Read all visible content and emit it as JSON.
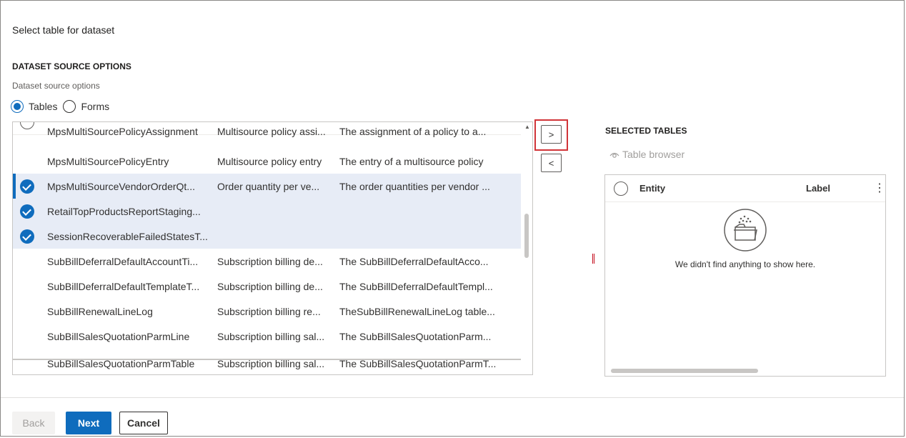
{
  "dialog": {
    "title": "Select table for dataset"
  },
  "source_options": {
    "heading": "DATASET SOURCE OPTIONS",
    "field_label": "Dataset source options",
    "options": [
      {
        "label": "Tables",
        "checked": true
      },
      {
        "label": "Forms",
        "checked": false
      }
    ]
  },
  "available_tables": {
    "rows": [
      {
        "name": "MpsMultiSourcePolicyAssignment",
        "label": "Multisource policy assi...",
        "description": "The assignment of a policy to a...",
        "selected": false
      },
      {
        "name": "MpsMultiSourcePolicyEntry",
        "label": "Multisource policy entry",
        "description": "The entry of a multisource policy",
        "selected": false
      },
      {
        "name": "MpsMultiSourceVendorOrderQt...",
        "label": "Order quantity per ve...",
        "description": "The order quantities per vendor ...",
        "selected": true
      },
      {
        "name": "RetailTopProductsReportStaging...",
        "label": "",
        "description": "",
        "selected": true
      },
      {
        "name": "SessionRecoverableFailedStatesT...",
        "label": "",
        "description": "",
        "selected": true
      },
      {
        "name": "SubBillDeferralDefaultAccountTi...",
        "label": "Subscription billing de...",
        "description": "The SubBillDeferralDefaultAcco...",
        "selected": false
      },
      {
        "name": "SubBillDeferralDefaultTemplateT...",
        "label": "Subscription billing de...",
        "description": "The SubBillDeferralDefaultTempl...",
        "selected": false
      },
      {
        "name": "SubBillRenewalLineLog",
        "label": "Subscription billing re...",
        "description": "TheSubBillRenewalLineLog table...",
        "selected": false
      },
      {
        "name": "SubBillSalesQuotationParmLine",
        "label": "Subscription billing sal...",
        "description": "The SubBillSalesQuotationParm...",
        "selected": false
      },
      {
        "name": "SubBillSalesQuotationParmTable",
        "label": "Subscription billing sal...",
        "description": "The SubBillSalesQuotationParmT...",
        "selected": false
      }
    ]
  },
  "transfer": {
    "add_label": ">",
    "remove_label": "<"
  },
  "selected_tables": {
    "heading": "SELECTED TABLES",
    "table_browser_label": "Table browser",
    "columns": {
      "entity": "Entity",
      "label": "Label",
      "more": "⋮"
    },
    "empty_message": "We didn't find anything to show here."
  },
  "footer": {
    "back_label": "Back",
    "next_label": "Next",
    "cancel_label": "Cancel"
  },
  "colors": {
    "accent": "#0f6cbd",
    "selected_row": "#e7ecf6",
    "highlight": "#d13438"
  },
  "icons": [
    "radio-icon",
    "checkmark-icon",
    "eye-icon",
    "empty-folder-icon",
    "more-options-icon"
  ]
}
